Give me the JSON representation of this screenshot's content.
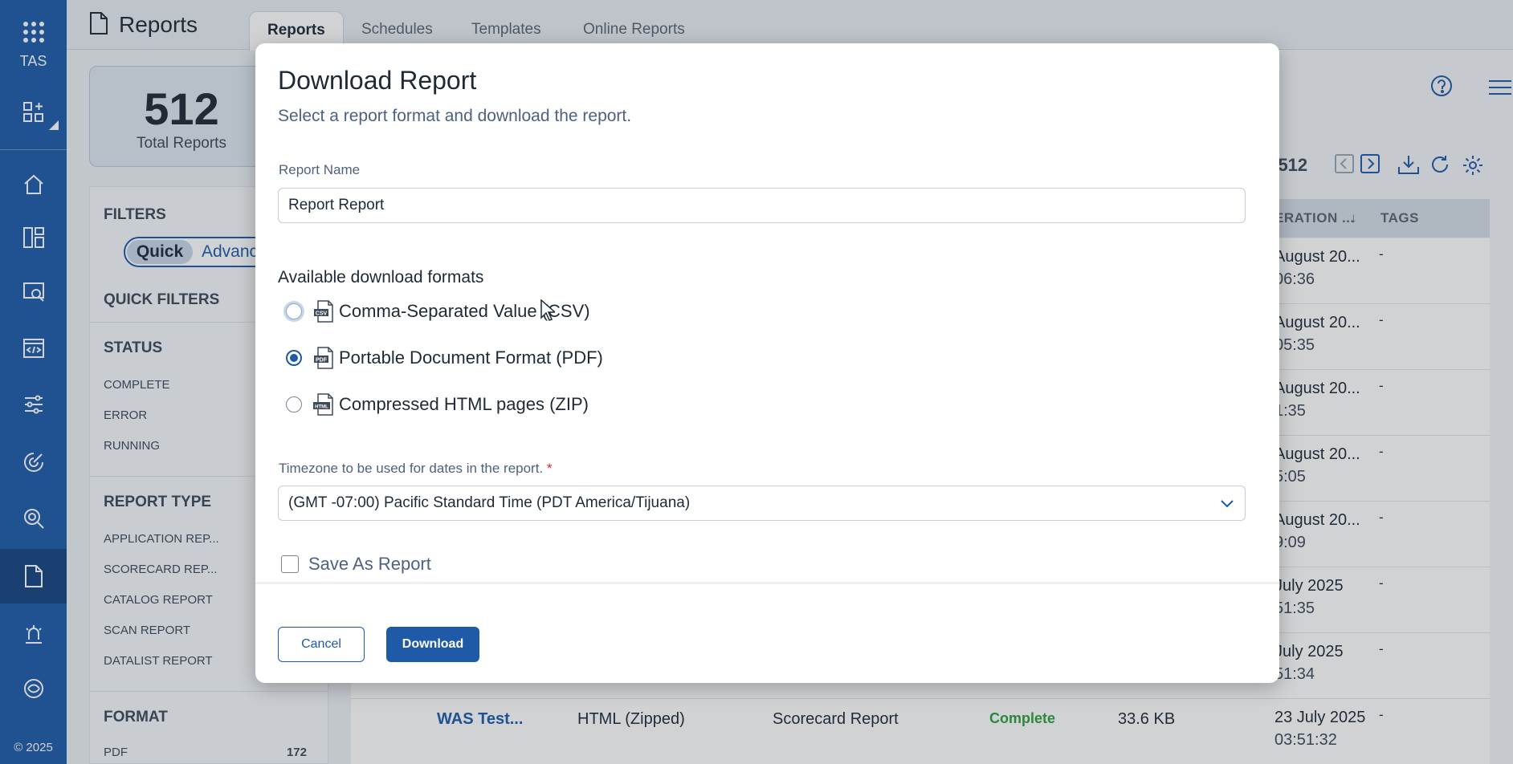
{
  "app": {
    "name": "TAS",
    "copyright": "© 2025"
  },
  "rail": {
    "icons": [
      "add-widget-icon",
      "home-icon",
      "dashboard-icon",
      "scan-icon",
      "code-icon",
      "sliders-icon",
      "radar-icon",
      "search-scan-icon",
      "reports-icon",
      "beacon-icon",
      "integration-icon"
    ]
  },
  "header": {
    "title": "Reports",
    "tabs": [
      "Reports",
      "Schedules",
      "Templates",
      "Online Reports"
    ]
  },
  "stats": {
    "total": "512",
    "label": "Total Reports"
  },
  "filters": {
    "title": "FILTERS",
    "toggle": {
      "quick": "Quick",
      "advanced": "Advanced"
    },
    "quick_filters": "QUICK FILTERS",
    "status": {
      "title": "STATUS",
      "items": [
        "COMPLETE",
        "ERROR",
        "RUNNING"
      ]
    },
    "report_type": {
      "title": "REPORT TYPE",
      "items": [
        "APPLICATION REP...",
        "SCORECARD REP...",
        "CATALOG REPORT",
        "SCAN REPORT",
        "DATALIST REPORT"
      ]
    },
    "format": {
      "title": "FORMAT",
      "items": [
        {
          "label": "PDF",
          "count": "172"
        }
      ]
    }
  },
  "table": {
    "pager": "f 512",
    "columns": {
      "generation": "ERATION ...",
      "sort": "↓",
      "tags": "TAGS"
    },
    "rows": [
      {
        "date": "August 20...",
        "time": "06:36",
        "tags": "-"
      },
      {
        "date": "August 20...",
        "time": "05:35",
        "tags": "-"
      },
      {
        "date": "August 20...",
        "time": "1:35",
        "tags": "-"
      },
      {
        "date": "August 20...",
        "time": "5:05",
        "tags": "-"
      },
      {
        "date": "August 20...",
        "time": "9:09",
        "tags": "-"
      },
      {
        "date": "July 2025",
        "time": "51:35",
        "tags": "-"
      },
      {
        "date": "July 2025",
        "time": "51:34",
        "tags": "-"
      }
    ],
    "last_row": {
      "name": "WAS Test...",
      "format": "HTML (Zipped)",
      "type": "Scorecard Report",
      "status": "Complete",
      "size": "33.6 KB",
      "date": "23 July 2025",
      "time": "03:51:32",
      "tags": "-"
    }
  },
  "modal": {
    "title": "Download Report",
    "subtitle": "Select a report format and download the report.",
    "report_name_label": "Report Name",
    "report_name_value": "Report Report",
    "formats_title": "Available download formats",
    "formats": [
      {
        "label": "Comma-Separated Value (CSV)",
        "icon": "csv-file-icon",
        "badge": "CSV",
        "checked": false
      },
      {
        "label": "Portable Document Format (PDF)",
        "icon": "pdf-file-icon",
        "badge": "PDF",
        "checked": true
      },
      {
        "label": "Compressed HTML pages (ZIP)",
        "icon": "html-file-icon",
        "badge": "HTML",
        "checked": false
      }
    ],
    "timezone_label": "Timezone to be used for dates in the report.",
    "timezone_required": "*",
    "timezone_value": "(GMT -07:00) Pacific Standard Time (PDT America/Tijuana)",
    "save_as_label": "Save As Report",
    "cancel_label": "Cancel",
    "download_label": "Download"
  },
  "colors": {
    "brand": "#1e5aa8",
    "status_complete": "#2e9e3e",
    "link": "#1e5aa8"
  }
}
